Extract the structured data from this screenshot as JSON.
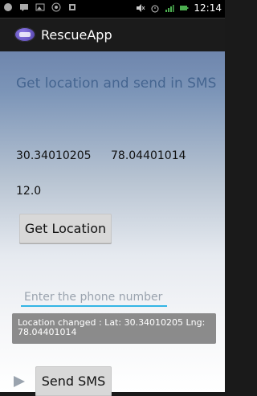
{
  "status_bar": {
    "time": "12:14"
  },
  "app": {
    "title": "RescueApp"
  },
  "main": {
    "title": "Get location and send in SMS",
    "latitude": "30.34010205",
    "longitude": "78.04401014",
    "accuracy": "12.0",
    "get_location_label": "Get Location",
    "phone_placeholder": "Enter the phone number",
    "toast_text": "Location changed : Lat: 30.34010205 Lng: 78.04401014",
    "send_sms_label": "Send SMS"
  },
  "colors": {
    "accent": "#33b5e5",
    "title_text": "#3c5e8a"
  }
}
